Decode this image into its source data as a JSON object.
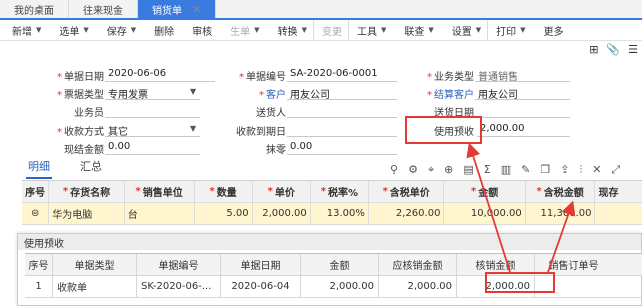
{
  "tabs": [
    {
      "label": "我的桌面"
    },
    {
      "label": "往来现金"
    },
    {
      "label": "销货单",
      "close": "✕"
    }
  ],
  "toolbar": [
    {
      "label": "新增",
      "arrow": "▼"
    },
    {
      "label": "选单",
      "arrow": "▼"
    },
    {
      "label": "保存",
      "arrow": "▼"
    },
    {
      "label": "删除"
    },
    {
      "label": "审核"
    },
    {
      "label": "生单",
      "arrow": "▼"
    },
    {
      "label": "转换",
      "arrow": "▼"
    },
    {
      "label": "变更"
    },
    {
      "label": "工具",
      "arrow": "▼"
    },
    {
      "label": "联查",
      "arrow": "▼"
    },
    {
      "label": "设置",
      "arrow": "▼"
    },
    {
      "label": "打印",
      "arrow": "▼"
    },
    {
      "label": "更多"
    }
  ],
  "form": {
    "date_label": "单据日期",
    "date_value": "2020-06-06",
    "billno_label": "单据编号",
    "billno_value": "SA-2020-06-0001",
    "biztype_label": "业务类型",
    "biztype_value": "普通销售",
    "invoice_label": "票据类型",
    "invoice_value": "专用发票",
    "customer_label": "客户",
    "customer_value": "用友公司",
    "settle_label": "结算客户",
    "settle_value": "用友公司",
    "salesman_label": "业务员",
    "deliverer_label": "送货人",
    "deliverdate_label": "送货日期",
    "payment_label": "收款方式",
    "payment_value": "其它",
    "duedate_label": "收款到期日",
    "prepay_label": "使用预收",
    "prepay_value": "2,000.00",
    "cash_label": "现结金额",
    "cash_value": "0.00",
    "discount_label": "抹零",
    "discount_value": "0.00"
  },
  "detail_tabs": [
    {
      "label": "明细"
    },
    {
      "label": "汇总"
    }
  ],
  "grid": {
    "headers": [
      "序号",
      "存货名称",
      "销售单位",
      "数量",
      "单价",
      "税率%",
      "含税单价",
      "金额",
      "含税金额",
      "现存"
    ],
    "row": {
      "name": "华为电脑",
      "unit": "台",
      "qty": "5.00",
      "price": "2,000.00",
      "tax": "13.00%",
      "taxprice": "2,260.00",
      "amount": "10,000.00",
      "taxamount": "11,300.00"
    }
  },
  "popup": {
    "title": "使用预收",
    "headers": [
      "序号",
      "单据类型",
      "单据编号",
      "单据日期",
      "金额",
      "应核销金额",
      "核销金额",
      "销售订单号"
    ],
    "row": {
      "no": "1",
      "type": "收款单",
      "billno": "SK-2020-06-...",
      "date": "2020-06-04",
      "amount": "2,000.00",
      "due": "2,000.00",
      "writeoff": "2,000.00",
      "order": ""
    }
  },
  "colors": {
    "accent": "#3a7be0",
    "highlight": "#e53935",
    "row_highlight": "#fff6cf"
  }
}
